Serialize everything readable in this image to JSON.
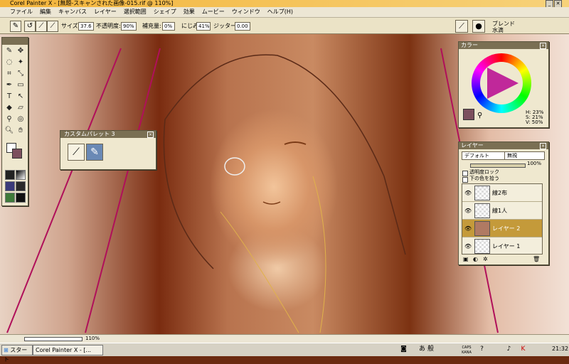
{
  "window": {
    "title": "Corel Painter X - [無題-スキャンされた画像-015.rif @ 110%]"
  },
  "menu": [
    "ファイル",
    "編集",
    "キャンバス",
    "レイヤー",
    "選択範囲",
    "シェイプ",
    "効果",
    "ムービー",
    "ウィンドウ",
    "ヘルプ(H)"
  ],
  "property_bar": {
    "size_label": "サイズ:",
    "size_value": "37.6",
    "opacity_label": "不透明度:",
    "opacity_value": "90%",
    "resat_label": "補充量:",
    "resat_value": "0%",
    "bleed_label": "にじみ:",
    "bleed_value": "41%",
    "jitter_label": "ジッター:",
    "jitter_value": "0.00",
    "brush_category": "ブレンド",
    "brush_variant": "水滴"
  },
  "custom_palette": {
    "title": "カスタムパレット 3"
  },
  "color_panel": {
    "title": "カラー",
    "h": "H: 23%",
    "s": "S: 21%",
    "v": "V: 50%"
  },
  "layers_panel": {
    "title": "レイヤー",
    "composite_method": "デフォルト",
    "composite_depth": "無視",
    "opacity_value": "100%",
    "preserve_transparency": "透明度ロック",
    "pick_up_color": "下の色を拾う",
    "layers": [
      {
        "name": "線2布",
        "selected": false
      },
      {
        "name": "線1人",
        "selected": false
      },
      {
        "name": "レイヤー 2",
        "selected": true
      },
      {
        "name": "レイヤー 1",
        "selected": false
      }
    ]
  },
  "status": {
    "zoom": "110%"
  },
  "taskbar": {
    "start_label": "スタート",
    "task_label": "Corel Painter X - [...",
    "ime_a": "あ",
    "ime_mode": "般",
    "caps": "CAPS",
    "kana": "KANA",
    "clock": "21:32"
  },
  "colors": {
    "accent": "#c49a3a",
    "title_bar": "#f3b43a",
    "primary_color": "#7c4f5e"
  }
}
